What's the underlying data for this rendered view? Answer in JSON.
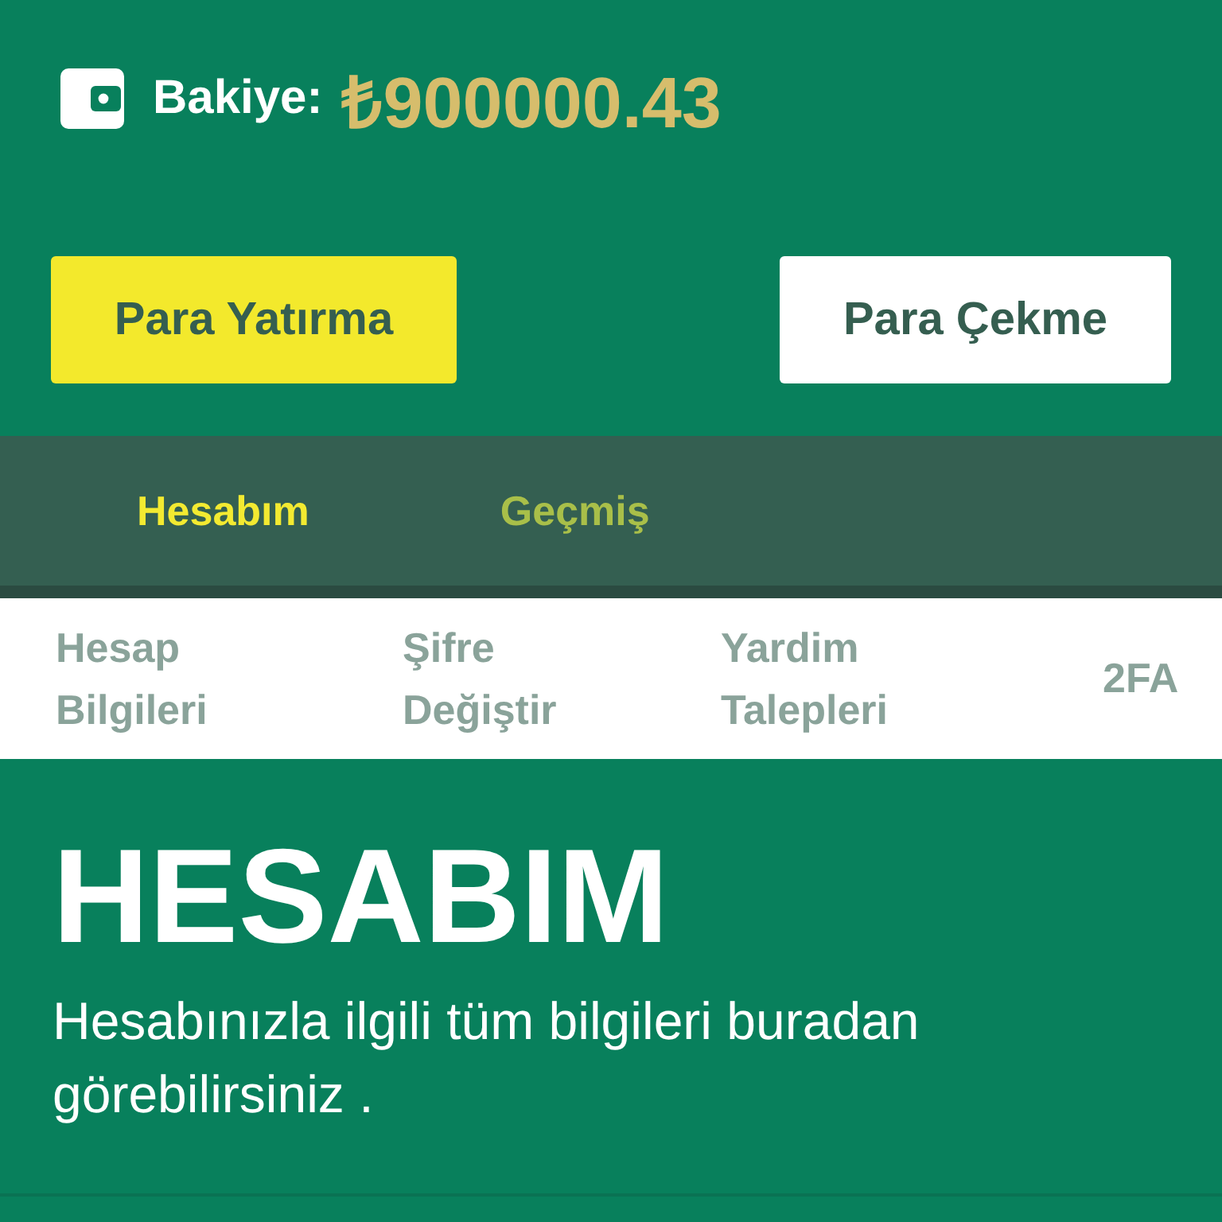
{
  "balance": {
    "label": "Bakiye:",
    "amount": "₺900000.43"
  },
  "actions": [
    {
      "label": "Para Yatırma",
      "kind": "primary"
    },
    {
      "label": "Para Çekme",
      "kind": "secondary"
    }
  ],
  "tabs": [
    {
      "label": "Hesabım",
      "selected": true
    },
    {
      "label": "Geçmiş",
      "selected": false
    }
  ],
  "subtabs": [
    {
      "label": "Hesap Bilgileri",
      "selected": false
    },
    {
      "label": "Şifre Değiştir",
      "selected": false
    },
    {
      "label": "Yardim Talepleri",
      "selected": false
    },
    {
      "label": "2FA",
      "selected": false
    }
  ],
  "page": {
    "title": "HESABIM",
    "description": "Hesabınızla ilgili tüm bilgileri buradan görebilirsiniz ."
  }
}
